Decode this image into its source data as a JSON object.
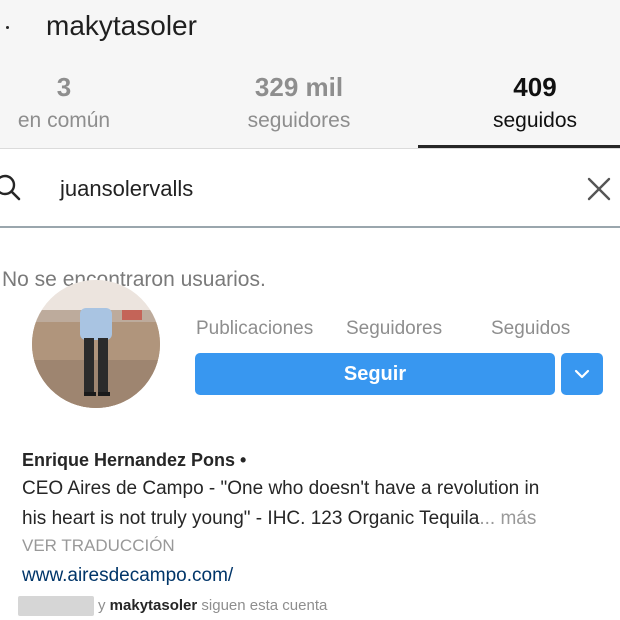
{
  "header": {
    "username": "makytasoler",
    "tabs": [
      {
        "count": "3",
        "label": "en común"
      },
      {
        "count": "329 mil",
        "label": "seguidores"
      },
      {
        "count": "409",
        "label": "seguidos",
        "active": true
      }
    ]
  },
  "search": {
    "query": "juansolervalls",
    "icon": "search-icon",
    "clear_icon": "close-icon"
  },
  "results": {
    "empty_message": "No se encontraron usuarios."
  },
  "profile": {
    "stats_labels": {
      "posts": "Publicaciones",
      "followers": "Seguidores",
      "following": "Seguidos"
    },
    "follow_label": "Seguir",
    "dropdown_icon": "chevron-down-icon",
    "full_name": "Enrique Hernandez Pons •",
    "bio_line1": "CEO Aires de Campo - \"One who doesn't have a revolution in",
    "bio_line2": "his heart is not truly young\" - IHC. 123 Organic Tequila",
    "more": "... más",
    "translate": "VER TRADUCCIÓN",
    "website": "www.airesdecampo.com/",
    "mutual": {
      "connector": "y",
      "username": "makytasoler",
      "suffix": "siguen esta cuenta"
    }
  },
  "colors": {
    "accent": "#3897f0",
    "link": "#003569",
    "muted": "#8e8e8e"
  }
}
